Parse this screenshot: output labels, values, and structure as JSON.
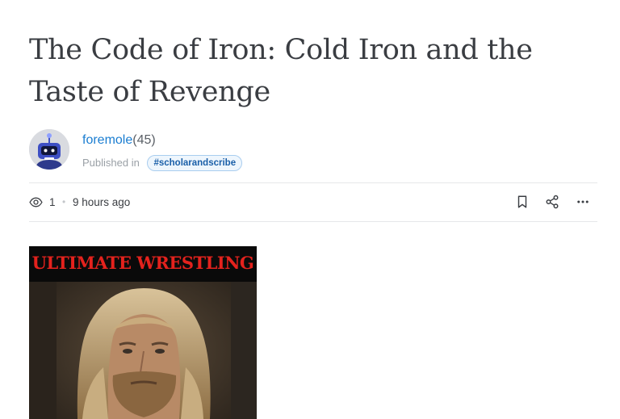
{
  "article": {
    "title": "The Code of Iron: Cold Iron and the Taste of Revenge"
  },
  "author": {
    "name": "foremole",
    "reputation": "(45)",
    "published_in_label": "Published in",
    "community_tag": "#scholarandscribe",
    "avatar_icon": "robot-avatar-icon"
  },
  "meta": {
    "views": "1",
    "separator": "•",
    "time_ago": "9 hours ago"
  },
  "actions": {
    "bookmark_icon": "bookmark-icon",
    "share_icon": "share-icon",
    "more_icon": "more-icon"
  },
  "cover_image": {
    "banner_text": "ULTIMATE WRESTLING"
  },
  "colors": {
    "link_blue": "#1a7dd1",
    "banner_red": "#e4221d"
  }
}
